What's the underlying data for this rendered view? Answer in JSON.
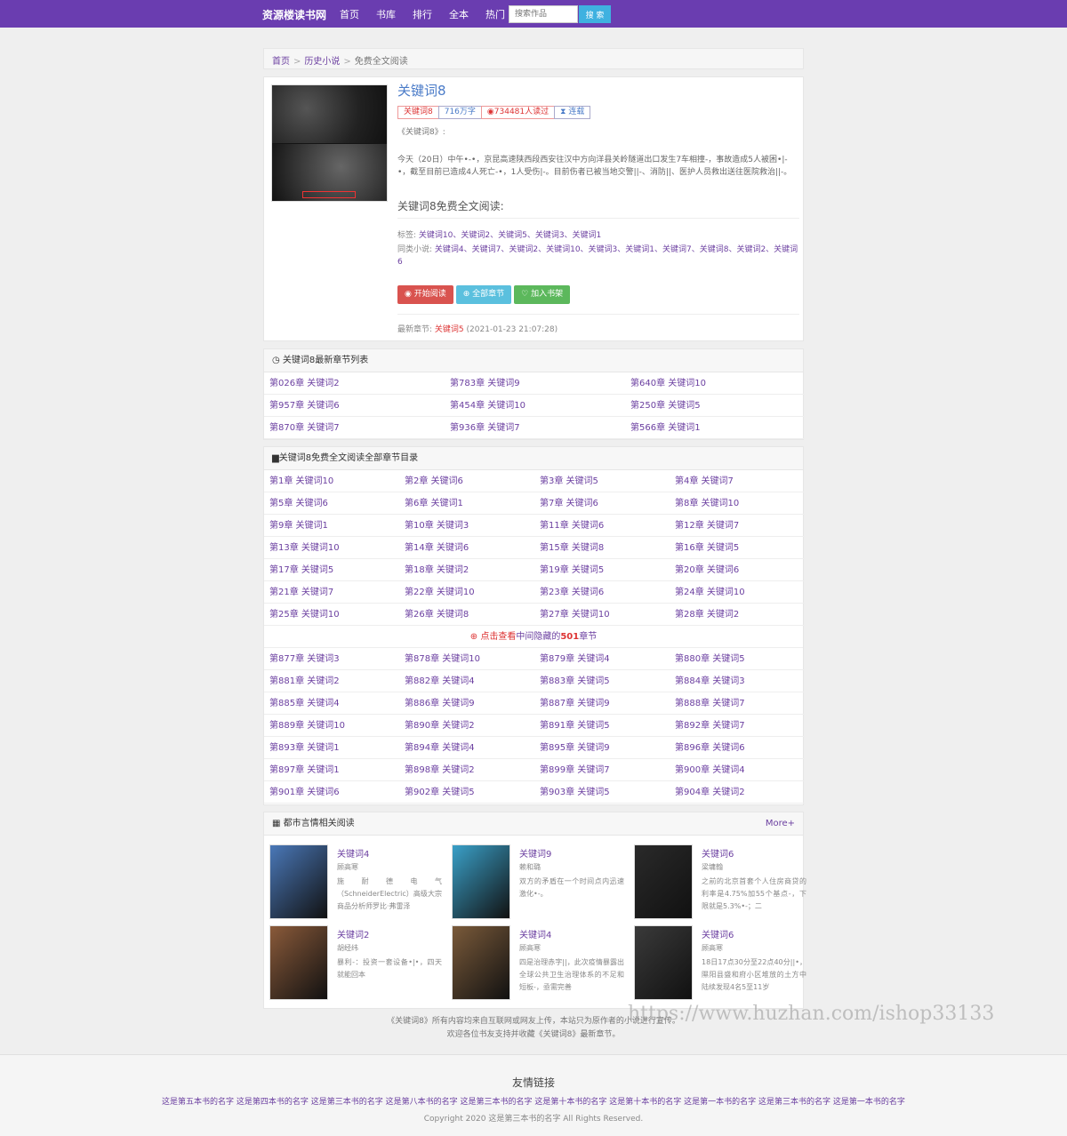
{
  "topbar": {
    "logo": "资源楼读书网",
    "nav": [
      "首页",
      "书库",
      "排行",
      "全本",
      "热门"
    ],
    "search_placeholder": "搜索作品",
    "search_button": "搜 索"
  },
  "breadcrumb": {
    "home": "首页",
    "category": "历史小说",
    "current": "免费全文阅读"
  },
  "book": {
    "title": "关键词8",
    "badges": [
      "关键词8",
      "716万字",
      "734481人读过",
      "连载"
    ],
    "desc_intro": "《关键词8》:",
    "desc": "今天（20日）中午•-•，京昆高速陕西段西安往汉中方向洋县关岭隧道出口发生7车相撞-，事故造成5人被困•|-•，截至目前已造成4人死亡-•，1人受伤|-。目前伤者已被当地交警||-、消防||、医护人员救出送往医院救治||-。",
    "read_heading": "关键词8免费全文阅读:",
    "tags_label": "标签:",
    "tags": "关键词10、关键词2、关键词5、关键词3、关键词1",
    "similar_label": "同类小说:",
    "similar": "关键词4、关键词7、关键词2、关键词10、关键词3、关键词1、关键词7、关键词8、关键词2、关键词6",
    "buttons": {
      "start": "开始阅读",
      "all": "全部章节",
      "shelf": "加入书架"
    },
    "latest_label": "最新章节:",
    "latest_chapter": "关键词5",
    "latest_time": "(2021-01-23 21:07:28)"
  },
  "newest": {
    "title": "关键词8最新章节列表",
    "items": [
      "第026章 关键词2",
      "第783章 关键词9",
      "第640章 关键词10",
      "第957章 关键词6",
      "第454章 关键词10",
      "第250章 关键词5",
      "第870章 关键词7",
      "第936章 关键词7",
      "第566章 关键词1"
    ]
  },
  "catalog": {
    "title": "关键词8免费全文阅读全部章节目录",
    "top": [
      "第1章 关键词10",
      "第2章 关键词6",
      "第3章 关键词5",
      "第4章 关键词7",
      "第5章 关键词6",
      "第6章 关键词1",
      "第7章 关键词6",
      "第8章 关键词10",
      "第9章 关键词1",
      "第10章 关键词3",
      "第11章 关键词6",
      "第12章 关键词7",
      "第13章 关键词10",
      "第14章 关键词6",
      "第15章 关键词8",
      "第16章 关键词5",
      "第17章 关键词5",
      "第18章 关键词2",
      "第19章 关键词5",
      "第20章 关键词6",
      "第21章 关键词7",
      "第22章 关键词10",
      "第23章 关键词6",
      "第24章 关键词10",
      "第25章 关键词10",
      "第26章 关键词8",
      "第27章 关键词10",
      "第28章 关键词2"
    ],
    "hidden_prefix": "点击查看",
    "hidden_mid": "中间隐藏的",
    "hidden_count": "501",
    "hidden_suffix": "章节",
    "bottom": [
      "第877章 关键词3",
      "第878章 关键词10",
      "第879章 关键词4",
      "第880章 关键词5",
      "第881章 关键词2",
      "第882章 关键词4",
      "第883章 关键词5",
      "第884章 关键词3",
      "第885章 关键词4",
      "第886章 关键词9",
      "第887章 关键词9",
      "第888章 关键词7",
      "第889章 关键词10",
      "第890章 关键词2",
      "第891章 关键词5",
      "第892章 关键词7",
      "第893章 关键词1",
      "第894章 关键词4",
      "第895章 关键词9",
      "第896章 关键词6",
      "第897章 关键词1",
      "第898章 关键词2",
      "第899章 关键词7",
      "第900章 关键词4",
      "第901章 关键词6",
      "第902章 关键词5",
      "第903章 关键词5",
      "第904章 关键词2"
    ]
  },
  "related": {
    "title": "都市言情相关阅读",
    "more": "More+",
    "items": [
      {
        "title": "关键词4",
        "author": "顾高寒",
        "desc": "施 耐 德 电 气 （SchneiderElectric）高级大宗商品分析师罗比·弗雷泽",
        "bg": "#4a78b8"
      },
      {
        "title": "关键词9",
        "author": "赖和璐",
        "desc": "双方的矛盾在一个时间点内迅速激化•-。",
        "bg": "#3aa0c8"
      },
      {
        "title": "关键词6",
        "author": "梁墉翰",
        "desc": "之前的北京首套个人住房商贷的利率是4.75%加55个基点-，下限就是5.3%•-；二",
        "bg": "#2a2a2a"
      },
      {
        "title": "关键词2",
        "author": "胡经纬",
        "desc": "暴利-：投资一套设备•|•，四天就能回本",
        "bg": "#8a5a3a"
      },
      {
        "title": "关键词4",
        "author": "顾高寒",
        "desc": "四是治理赤字||，此次疫情暴露出全球公共卫生治理体系的不足和短板-，亟需完善",
        "bg": "#7a5a3a"
      },
      {
        "title": "关键词6",
        "author": "顾高寒",
        "desc": "18日17点30分至22点40分||•，隰阳县盛和府小区堆放的土方中陆续发现4名5至11岁",
        "bg": "#3a3a3a"
      }
    ]
  },
  "copyright": {
    "line1": "《关键词8》所有内容均来自互联网或网友上传，本站只为原作者的小说进行宣传。",
    "line2": "欢迎各位书友支持并收藏《关键词8》最新章节。"
  },
  "watermark": "https://www.huzhan.com/ishop33133",
  "footer": {
    "title": "友情链接",
    "links": [
      "这是第五本书的名字",
      "这是第四本书的名字",
      "这是第三本书的名字",
      "这是第八本书的名字",
      "这是第三本书的名字",
      "这是第十本书的名字",
      "这是第十本书的名字",
      "这是第一本书的名字",
      "这是第三本书的名字",
      "这是第一本书的名字"
    ],
    "copyright": "Copyright 2020 这是第三本书的名字 All Rights Reserved."
  },
  "colors": {
    "brand": "#6a3db0",
    "link": "#6b3fa0",
    "accent_red": "#d33"
  }
}
